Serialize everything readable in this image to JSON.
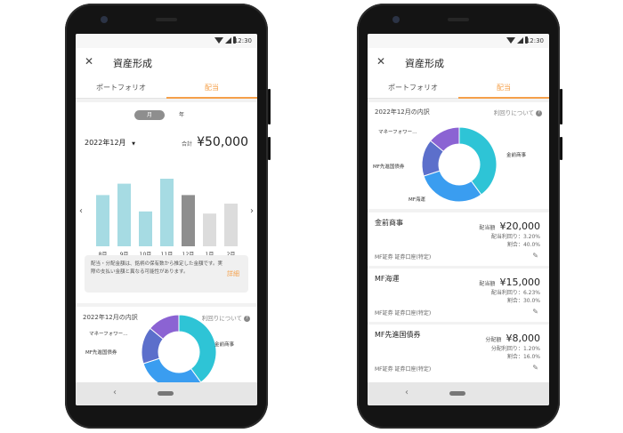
{
  "status": {
    "time": "12:30"
  },
  "app": {
    "title": "資産形成",
    "tabs": [
      "ポートフォリオ",
      "配当"
    ]
  },
  "left": {
    "period_toggle": [
      "月",
      "年"
    ],
    "month_label": "2022年12月",
    "total_label": "合計",
    "total_value": "¥50,000",
    "chart_data": {
      "type": "bar",
      "categories": [
        "8月",
        "9月",
        "10月",
        "11月",
        "12月",
        "1月",
        "2月"
      ],
      "values": [
        0.72,
        0.88,
        0.49,
        0.95,
        0.72,
        0.46,
        0.6
      ],
      "series_colors": [
        "#a6dbe3",
        "#a6dbe3",
        "#a6dbe3",
        "#a6dbe3",
        "#8e8e8e",
        "#dcdcdc",
        "#dcdcdc"
      ]
    },
    "note": "配当・分配金額は、銘柄の保有数から推定した金額です。実際の支払い金額と異なる可能性があります。",
    "note_link": "詳細",
    "breakdown_title": "2022年12月の内訳",
    "yield_link": "利回りについて"
  },
  "right": {
    "breakdown_title": "2022年12月の内訳",
    "yield_link": "利回りについて",
    "items": [
      {
        "name": "金前商事",
        "amount_label": "配当額",
        "amount": "¥20,000",
        "yield_label": "配当利回り：",
        "yield": "3.20%",
        "share_label": "割合：",
        "share": "40.0%",
        "account": "MF証券 証券口座(特定)"
      },
      {
        "name": "MF海運",
        "amount_label": "配当額",
        "amount": "¥15,000",
        "yield_label": "配当利回り：",
        "yield": "6.23%",
        "share_label": "割合：",
        "share": "30.0%",
        "account": "MF証券 証券口座(特定)"
      },
      {
        "name": "MF先進国債券",
        "amount_label": "分配額",
        "amount": "¥8,000",
        "yield_label": "分配利回り：",
        "yield": "1.20%",
        "share_label": "割合：",
        "share": "16.0%",
        "account": "MF証券 証券口座(特定)"
      }
    ]
  },
  "donut": {
    "chart_data": {
      "type": "pie",
      "categories": [
        "金前商事",
        "MF海運",
        "MF先進国債券",
        "マネーフォワー…"
      ],
      "values": [
        40.0,
        30.0,
        16.0,
        14.0
      ],
      "colors": [
        "#2ec4d6",
        "#3a9df0",
        "#5c6fcb",
        "#8b63d3"
      ]
    }
  }
}
